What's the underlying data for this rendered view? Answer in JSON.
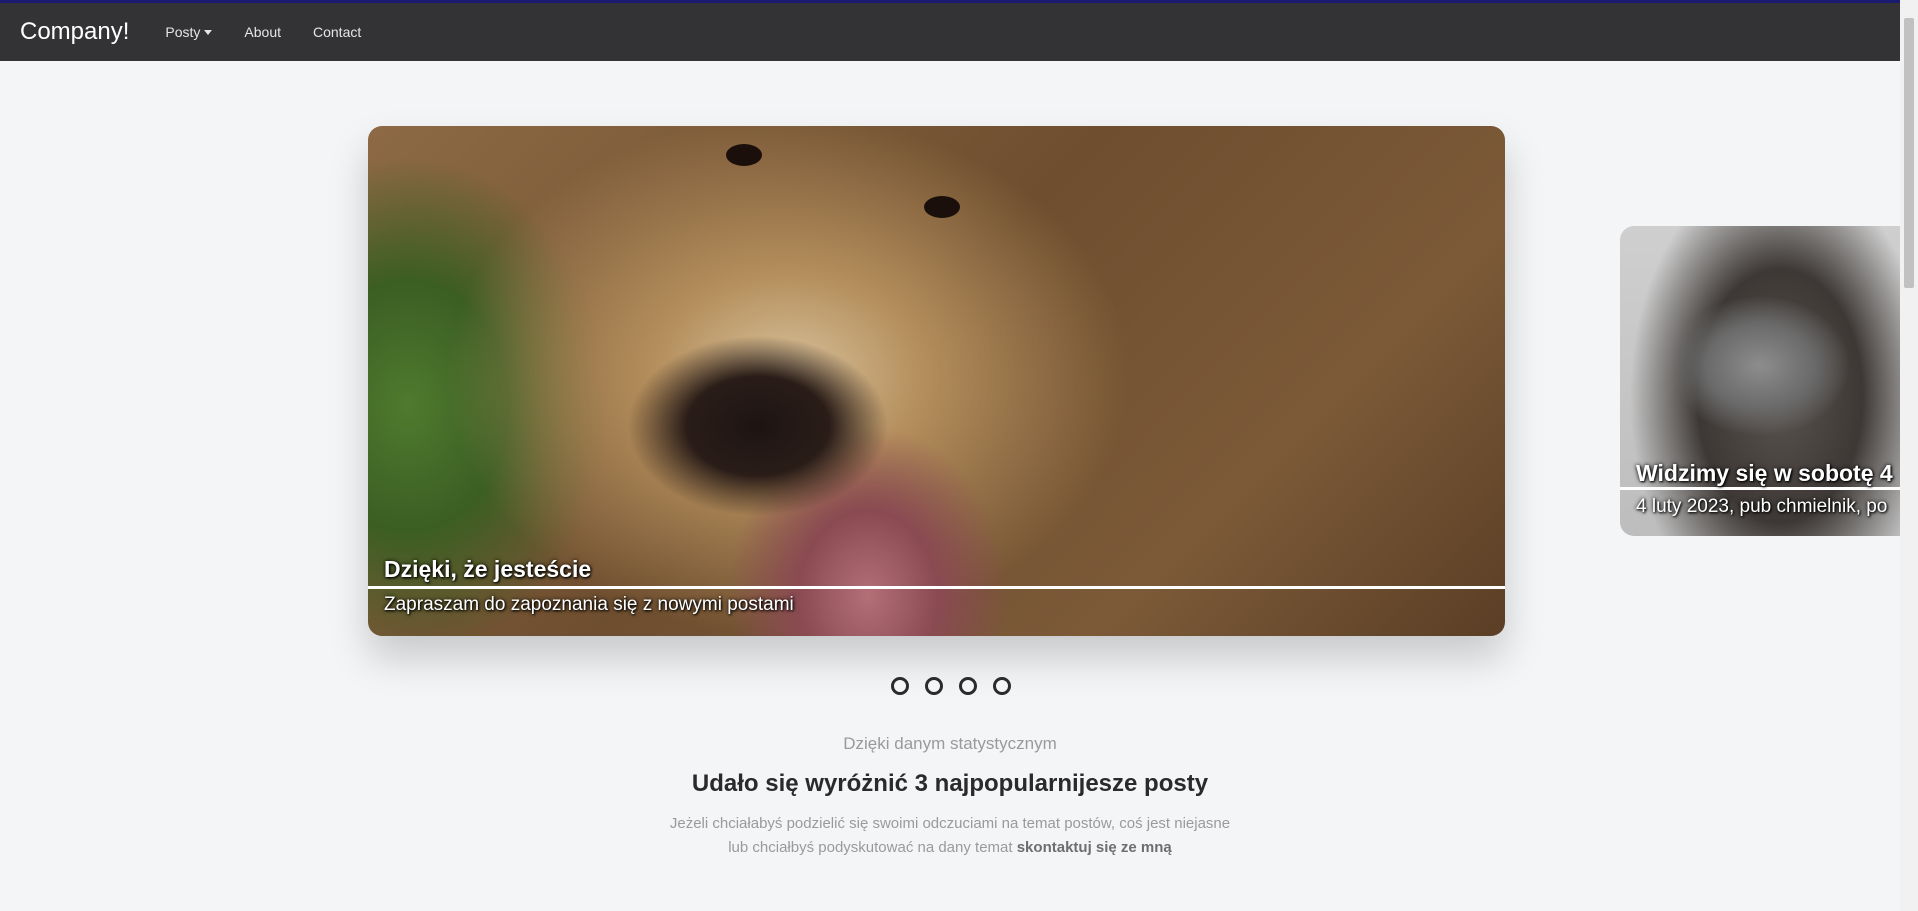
{
  "navbar": {
    "brand": "Company!",
    "items": [
      {
        "label": "Posty",
        "dropdown": true
      },
      {
        "label": "About"
      },
      {
        "label": "Contact"
      }
    ]
  },
  "carousel": {
    "active": {
      "title": "Dzięki, że jesteście",
      "text": "Zapraszam do zapoznania się z nowymi postami"
    },
    "next": {
      "title": "Widzimy się w sobotę 4",
      "text": "4 luty 2023, pub chmielnik, po"
    },
    "indicator_count": 4
  },
  "section": {
    "kicker": "Dzięki danym statystycznym",
    "headline": "Udało się wyróżnić 3 najpopularnijesze posty",
    "para_line1": "Jeżeli chciałabyś podzielić się swoimi odczuciami na temat postów, coś jest niejasne",
    "para_line2_prefix": "lub chciałbyś podyskutować na dany temat ",
    "para_link": "skontaktuj się ze mną"
  },
  "colors": {
    "navbar_bg": "#333335",
    "page_bg": "#f4f5f7",
    "accent_line": "#1a1a6e"
  }
}
